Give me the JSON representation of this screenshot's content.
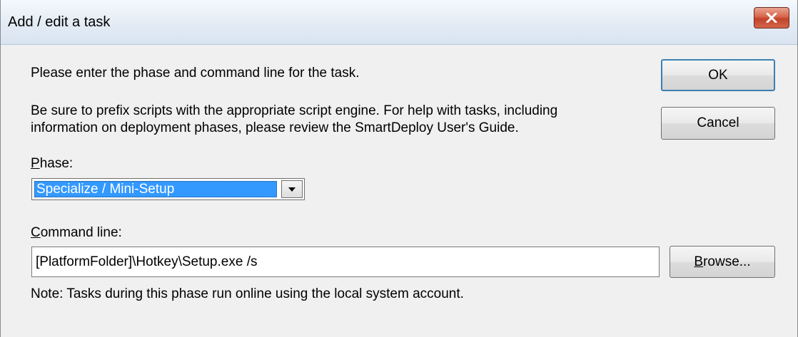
{
  "window": {
    "title": "Add / edit a task",
    "close_icon": "close-icon",
    "close_color": "#c8452c"
  },
  "content": {
    "intro_text": "Please enter the phase and command line for the task.",
    "help_text_line1": "Be sure to prefix scripts with the appropriate script engine. For help with tasks, including",
    "help_text_line2": "information on deployment phases, please review the SmartDeploy User's Guide.",
    "note_text": "Note: Tasks during this phase run online using the local system account."
  },
  "phase": {
    "label_mnemonic": "P",
    "label_rest": "hase:",
    "selected_value": "Specialize / Mini-Setup",
    "arrow_icon": "chevron-down-icon"
  },
  "command_line": {
    "label_mnemonic": "C",
    "label_rest": "ommand line:",
    "value": "[PlatformFolder]\\Hotkey\\Setup.exe /s"
  },
  "buttons": {
    "ok": "OK",
    "cancel": "Cancel",
    "browse_mnemonic": "B",
    "browse_rest": "rowse..."
  }
}
